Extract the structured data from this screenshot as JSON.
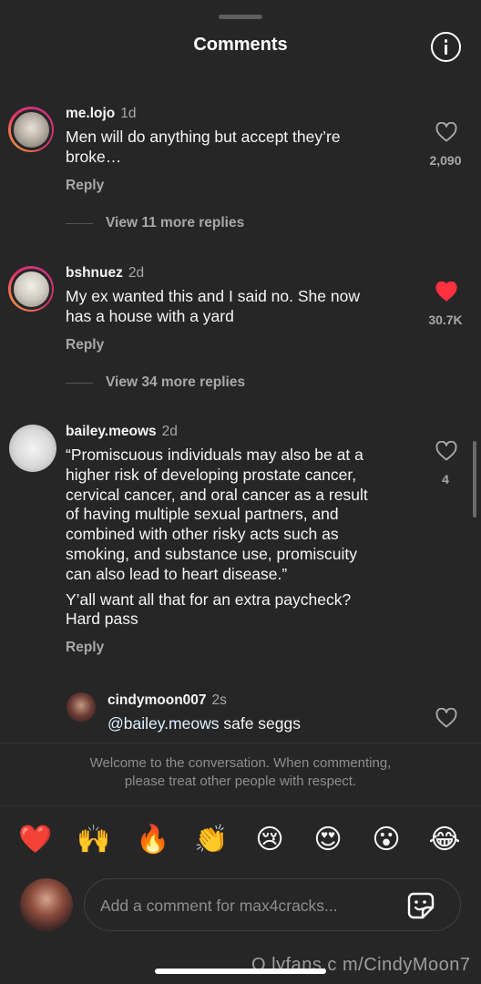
{
  "header": {
    "title": "Comments",
    "info_icon": "info-icon"
  },
  "comments": [
    {
      "username": "me.lojo",
      "time": "1d",
      "lines": [
        "Men will do anything but accept they’re",
        "broke…"
      ],
      "reply_label": "Reply",
      "likes": "2,090",
      "liked": false,
      "view_replies": "View 11 more replies"
    },
    {
      "username": "bshnuez",
      "time": "2d",
      "lines": [
        "My ex wanted this and I said no. She now",
        "has a house with a yard"
      ],
      "reply_label": "Reply",
      "likes": "30.7K",
      "liked": true,
      "view_replies": "View 34 more replies"
    },
    {
      "username": "bailey.meows",
      "time": "2d",
      "lines": [
        "“Promiscuous individuals may also be at a",
        "higher risk of developing prostate cancer,",
        "cervical cancer, and oral cancer as a result",
        "of having multiple sexual partners, and",
        "combined with other risky acts such as",
        "smoking, and substance use, promiscuity",
        "can also lead to heart disease.”"
      ],
      "lines2": [
        "Y’all want all that for an extra paycheck?",
        "Hard pass"
      ],
      "reply_label": "Reply",
      "likes": "4",
      "liked": false
    }
  ],
  "reply": {
    "username": "cindymoon007",
    "time": "2s",
    "mention": "@bailey.meows",
    "text": " safe seggs"
  },
  "notice": [
    "Welcome to the conversation. When commenting,",
    "please treat other people with respect."
  ],
  "emojis": [
    "❤️",
    "🙌",
    "🔥",
    "👏",
    "😢",
    "😍",
    "😮",
    "😂"
  ],
  "composer": {
    "placeholder": "Add a comment for max4cracks..."
  },
  "watermark": "O lyfans.c m/CindyMoon7",
  "colors": {
    "background": "#262626",
    "like_red": "#ff3040",
    "muted": "#a8a8a8"
  }
}
